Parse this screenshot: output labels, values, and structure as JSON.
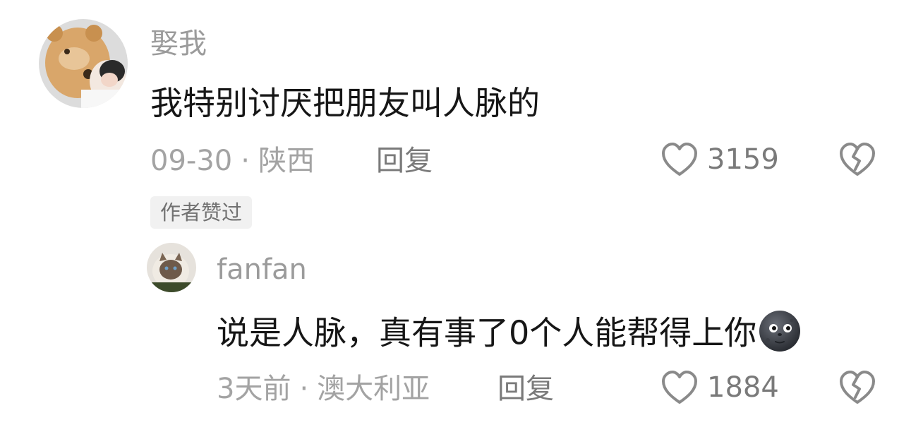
{
  "comments": [
    {
      "username": "娶我",
      "text": "我特别讨厌把朋友叫人脉的",
      "date": "09-30",
      "location": "陕西",
      "reply_label": "回复",
      "likes": "3159",
      "badge": "作者赞过"
    }
  ],
  "replies": [
    {
      "username": "fanfan",
      "text": "说是人脉，真有事了0个人能帮得上你",
      "emoji": "new-moon-face-icon",
      "date": "3天前",
      "location": "澳大利亚",
      "reply_label": "回复",
      "likes": "1884"
    }
  ],
  "meta_separator": "·",
  "colors": {
    "text": "#161616",
    "secondary": "#9b9b9b",
    "badge_bg": "#f1f1f1"
  }
}
